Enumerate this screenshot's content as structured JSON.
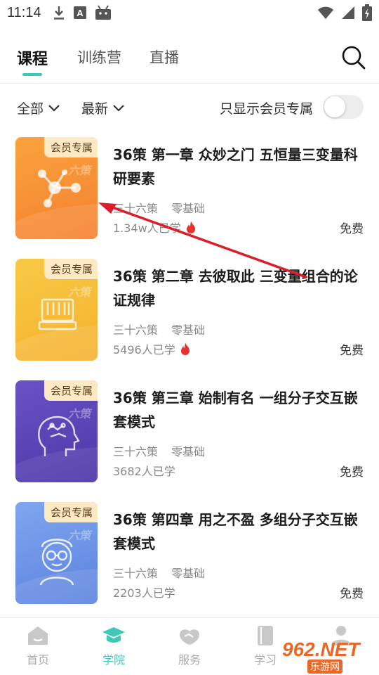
{
  "status_bar": {
    "time": "11:14",
    "icons": [
      "download-icon",
      "a-icon",
      "android-icon",
      "wifi-icon",
      "signal-icon",
      "battery-icon"
    ]
  },
  "tabs": [
    {
      "label": "课程",
      "active": true
    },
    {
      "label": "训练营",
      "active": false
    },
    {
      "label": "直播",
      "active": false
    }
  ],
  "filters": {
    "category": "全部",
    "sort": "最新",
    "member_only_label": "只显示会员专属",
    "member_only_on": false
  },
  "courses": [
    {
      "badge": "会员专属",
      "thumb_mark": "六策",
      "title": "36策 第一章 众妙之门 五恒量三变量科研要素",
      "tags": [
        "三十六策",
        "零基础"
      ],
      "learned": "1.34w人已学",
      "hot": true,
      "price": "免费",
      "color": "#f7913a",
      "icon": "molecule-icon"
    },
    {
      "badge": "会员专属",
      "thumb_mark": "六策",
      "title": "36策 第二章 去彼取此 三变量组合的论证规律",
      "tags": [
        "三十六策",
        "零基础"
      ],
      "learned": "5496人已学",
      "hot": true,
      "price": "免费",
      "color": "#f6be3a",
      "icon": "abacus-icon"
    },
    {
      "badge": "会员专属",
      "thumb_mark": "六策",
      "title": "36策 第三章 始制有名 一组分子交互嵌套模式",
      "tags": [
        "三十六策",
        "零基础"
      ],
      "learned": "3682人已学",
      "hot": false,
      "price": "免费",
      "color": "#5a45b5",
      "icon": "brain-head-icon"
    },
    {
      "badge": "会员专属",
      "thumb_mark": "六策",
      "title": "36策 第四章 用之不盈 多组分子交互嵌套模式",
      "tags": [
        "三十六策",
        "零基础"
      ],
      "learned": "2203人已学",
      "hot": false,
      "price": "免费",
      "color": "#6e95e9",
      "icon": "scientist-icon"
    }
  ],
  "bottom_nav": [
    {
      "label": "首页",
      "icon": "home-icon",
      "active": false
    },
    {
      "label": "学院",
      "icon": "graduation-cap-icon",
      "active": true
    },
    {
      "label": "服务",
      "icon": "handshake-icon",
      "active": false
    },
    {
      "label": "学习",
      "icon": "book-icon",
      "active": false
    },
    {
      "label": "",
      "icon": "profile-icon",
      "active": false
    }
  ],
  "watermark": {
    "logo": "962.NET",
    "sub": "乐游网"
  },
  "colors": {
    "accent": "#3dc8b9",
    "annotation_arrow": "#d9202a",
    "hot": "#e5322d"
  }
}
